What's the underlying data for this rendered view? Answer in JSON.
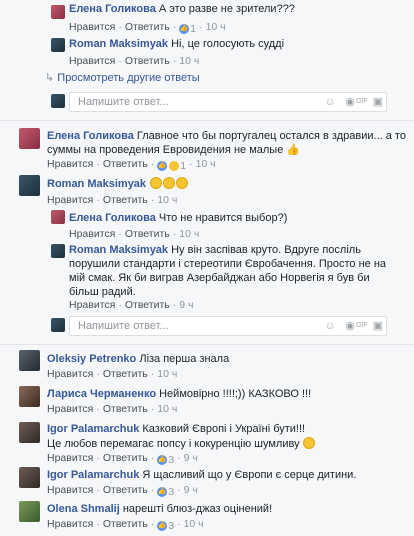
{
  "comments": {
    "reply1": {
      "author": "Елена Голикова",
      "text": "А это разве не зрители???",
      "like": "Нравится",
      "reply": "Ответить",
      "count": "1",
      "time": "10 ч"
    },
    "reply2": {
      "author": "Roman Maksimyak",
      "text": "Ні, це голосують судді",
      "like": "Нравится",
      "reply": "Ответить",
      "time": "10 ч"
    },
    "more_replies": "Просмотреть другие ответы",
    "reply_placeholder": "Напишите ответ...",
    "c1": {
      "author": "Елена Голикова",
      "text1": "Главное что бы португалец остался в здравии... а то",
      "text2": "суммы на проведения Евровидения не малые",
      "like": "Нравится",
      "reply": "Ответить",
      "count": "1",
      "time": "10 ч"
    },
    "c2": {
      "author": "Roman Maksimyak",
      "like": "Нравится",
      "reply": "Ответить",
      "time": "10 ч"
    },
    "c2r1": {
      "author": "Елена Голикова",
      "text": "Что не нравится выбор?)",
      "like": "Нравится",
      "reply": "Ответить",
      "time": "10 ч"
    },
    "c2r2": {
      "author": "Roman Maksimyak",
      "text1": "Ну він заспівав круто. Вдруге посліль",
      "text2": "порушили стандарти і стереотипи Євробачення. Просто не на",
      "text3": "мій смак. Як би виграв Азербайджан або Норвегія я був би",
      "text4": "більш радий.",
      "like": "Нравится",
      "reply": "Ответить",
      "time": "9 ч"
    },
    "c3": {
      "author": "Oleksiy Petrenko",
      "text": "Ліза перша знала",
      "like": "Нравится",
      "reply": "Ответить",
      "time": "10 ч"
    },
    "c4": {
      "author": "Лариса Черманенко",
      "text": "Неймовірно !!!!;)) КАЗКОВО !!!",
      "like": "Нравится",
      "reply": "Ответить",
      "time": "10 ч"
    },
    "c5": {
      "author": "Igor Palamarchuk",
      "text1": "Казковий Європі і Україні бути!!!",
      "text2": "Це любов перемагає попсу і кокуренцію шумливу",
      "like": "Нравится",
      "reply": "Ответить",
      "count": "3",
      "time": "9 ч"
    },
    "c6": {
      "author": "Igor Palamarchuk",
      "text": "Я щасливий що у Європи є серце дитини.",
      "like": "Нравится",
      "reply": "Ответить",
      "count": "3",
      "time": "9 ч"
    },
    "c7": {
      "author": "Olena Shmalij",
      "text": "нарешті блюз-джаз оцінений!",
      "like": "Нравится",
      "reply": "Ответить",
      "count": "3",
      "time": "10 ч"
    }
  }
}
